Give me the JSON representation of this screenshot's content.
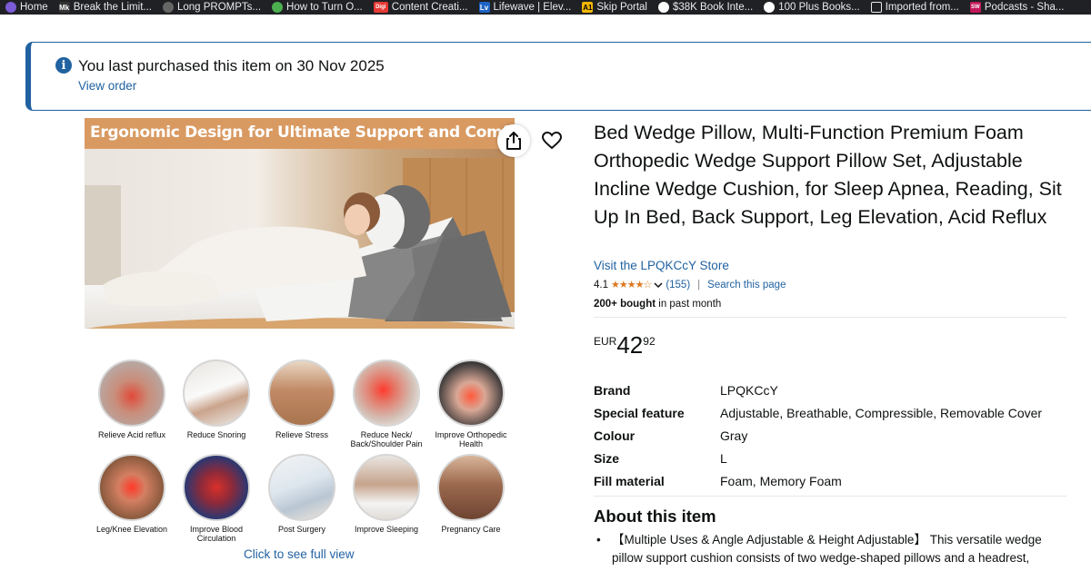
{
  "bookmarks": [
    {
      "label": "Home",
      "icon": "home-icon",
      "color": "#7b5cd6",
      "glyph": ""
    },
    {
      "label": "Break the Limit...",
      "icon": "mk-icon",
      "color": "#333333",
      "glyph": "Mk"
    },
    {
      "label": "Long PROMPTs...",
      "icon": "prompt-icon",
      "color": "#666666",
      "glyph": ""
    },
    {
      "label": "How to Turn O...",
      "icon": "globe-icon",
      "color": "#4caf50",
      "glyph": ""
    },
    {
      "label": "Content Creati...",
      "icon": "digi-icon",
      "color": "#e53935",
      "glyph": "Digi"
    },
    {
      "label": "Lifewave | Elev...",
      "icon": "lifewave-icon",
      "color": "#1e63c4",
      "glyph": "Lv"
    },
    {
      "label": "Skip Portal",
      "icon": "skip-icon",
      "color": "#f2b705",
      "glyph": "A1"
    },
    {
      "label": "$38K Book Inte...",
      "icon": "book-icon",
      "color": "#222222",
      "glyph": ""
    },
    {
      "label": "100 Plus Books...",
      "icon": "books-icon",
      "color": "#222222",
      "glyph": ""
    },
    {
      "label": "Imported from...",
      "icon": "folder-icon",
      "color": "#202124",
      "glyph": ""
    },
    {
      "label": "Podcasts - Sha...",
      "icon": "sw-icon",
      "color": "#c2185b",
      "glyph": "SW"
    }
  ],
  "notice": {
    "message": "You last purchased this item on 30 Nov 2025",
    "link": "View order",
    "accent": "#2162a1"
  },
  "image": {
    "banner_text": "Ergonomic Design for Ultimate Support and Comfort",
    "full_view_link": "Click to see full view"
  },
  "benefits": [
    {
      "label": "Relieve Acid reflux"
    },
    {
      "label": "Reduce Snoring"
    },
    {
      "label": "Relieve Stress"
    },
    {
      "label": "Reduce Neck/ Back/Shoulder Pain"
    },
    {
      "label": "Improve Orthopedic Health"
    },
    {
      "label": "Leg/Knee Elevation"
    },
    {
      "label": "Improve Blood Circulation"
    },
    {
      "label": "Post Surgery"
    },
    {
      "label": "Improve Sleeping"
    },
    {
      "label": "Pregnancy Care"
    }
  ],
  "product": {
    "title": "Bed Wedge Pillow, Multi-Function Premium Foam Orthopedic Wedge Support Pillow Set, Adjustable Incline Wedge Cushion, for Sleep Apnea, Reading, Sit Up In Bed, Back Support, Leg Elevation, Acid Reflux",
    "store_link": "Visit the LPQKCcY Store",
    "rating": "4.1",
    "rating_fraction": 0.82,
    "review_count": "(155)",
    "search_link": "Search this page",
    "bought_bold": "200+ bought",
    "bought_rest": " in past month",
    "price_currency": "EUR",
    "price_whole": "42",
    "price_fraction": "92",
    "star_color": "#de7921"
  },
  "specs": [
    {
      "key": "Brand",
      "value": "LPQKCcY"
    },
    {
      "key": "Special feature",
      "value": "Adjustable, Breathable, Compressible, Removable Cover"
    },
    {
      "key": "Colour",
      "value": "Gray"
    },
    {
      "key": "Size",
      "value": "L"
    },
    {
      "key": "Fill material",
      "value": "Foam, Memory Foam"
    }
  ],
  "about": {
    "title": "About this item",
    "bullets": [
      "【Multiple Uses & Angle Adjustable & Height Adjustable】 This versatile wedge pillow support cushion consists of two wedge-shaped pillows and a headrest,"
    ]
  }
}
